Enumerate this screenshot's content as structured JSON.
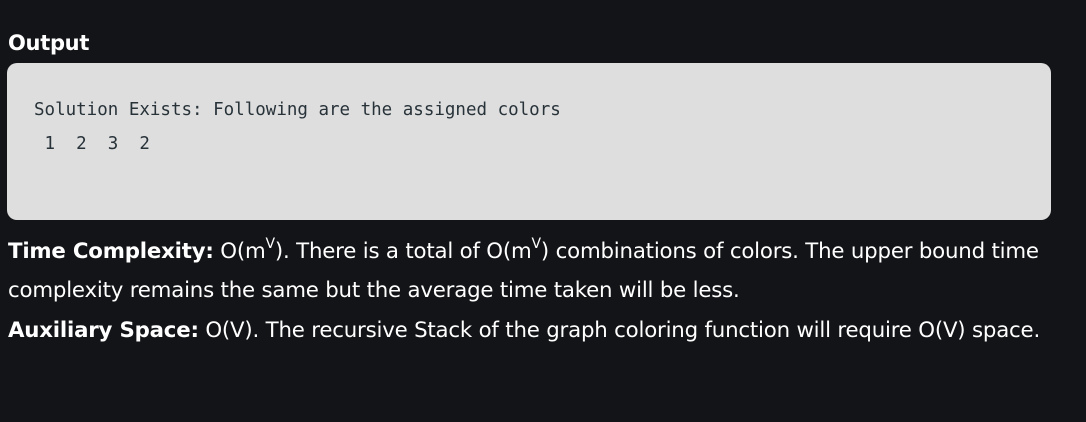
{
  "heading": "Output",
  "code_output": {
    "line1": "Solution Exists: Following are the assigned colors",
    "line2": " 1  2  3  2"
  },
  "time_complexity": {
    "label": "Time Complexity:",
    "sentence_a": " O(m",
    "sup_a": "V",
    "sentence_b": "). There is a total of O(m",
    "sup_b": "V",
    "sentence_c": ") combinations of colors. The upper bound time complexity remains the same but the average time taken will be less."
  },
  "auxiliary_space": {
    "label": "Auxiliary Space:",
    "text": " O(V). The recursive Stack of the graph coloring function will require O(V) space."
  }
}
